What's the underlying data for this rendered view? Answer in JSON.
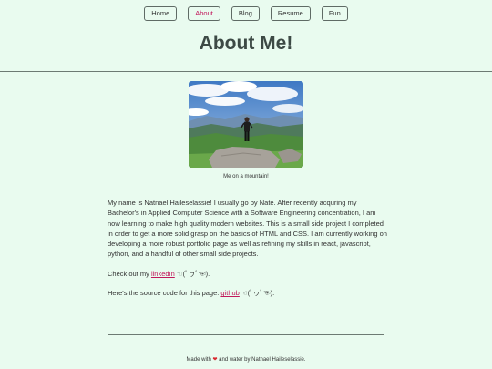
{
  "nav": {
    "items": [
      {
        "label": "Home"
      },
      {
        "label": "About"
      },
      {
        "label": "Blog"
      },
      {
        "label": "Resume"
      },
      {
        "label": "Fun"
      }
    ],
    "active": "About"
  },
  "page": {
    "title": "About Me!"
  },
  "photo": {
    "caption": "Me on a mountain!"
  },
  "bio": {
    "paragraph": "My name is Natnael Haileselassie! I usually go by Nate. After recently acquring my Bachelor's in Applied Computer Science with a Software Engineering concentration, I am now learning to make high quality modern websites. This is a small side project I completed in order to get a more solid grasp on the basics of HTML and CSS. I am currently working on developing a more robust portfolio page as well as refining my skills in react, javascript, python, and a handful of other small side projects.",
    "linkedin_prefix": "Check out my ",
    "linkedin_label": "linkedIn",
    "linkedin_suffix": " ☜(ﾟヮﾟ☜).",
    "source_prefix": "Here's the source code for this page: ",
    "github_label": "github",
    "source_suffix": " ☜(ﾟヮﾟ☜)."
  },
  "footer": {
    "prefix": "Made with ",
    "heart": "❤",
    "suffix": " and water by Natnael Haileselassie."
  },
  "colors": {
    "accent": "#c2185b",
    "background": "#e9fbef",
    "heading": "#3d4a45"
  }
}
